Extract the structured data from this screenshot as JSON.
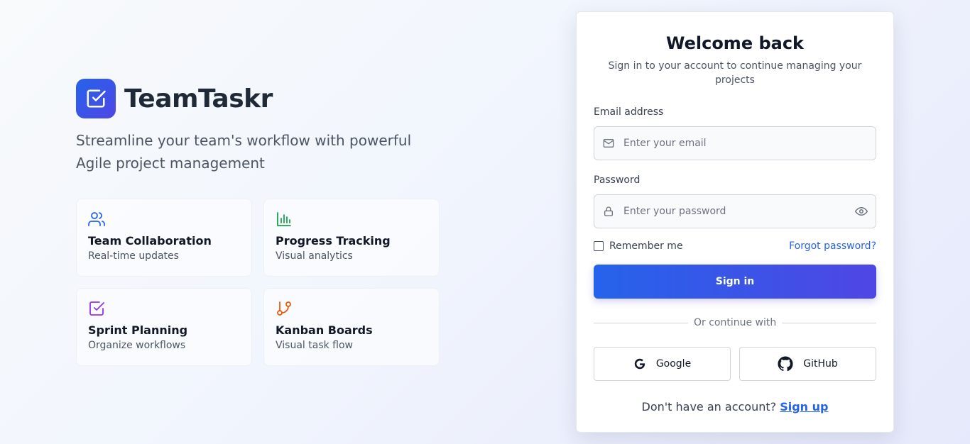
{
  "brand": {
    "name": "TeamTaskr",
    "tagline": "Streamline your team's workflow with powerful Agile project management"
  },
  "features": [
    {
      "icon": "users-icon",
      "title": "Team Collaboration",
      "subtitle": "Real-time updates",
      "color": "#2563eb"
    },
    {
      "icon": "bar-chart-icon",
      "title": "Progress Tracking",
      "subtitle": "Visual analytics",
      "color": "#16a34a"
    },
    {
      "icon": "check-square-icon",
      "title": "Sprint Planning",
      "subtitle": "Organize workflows",
      "color": "#9333ea"
    },
    {
      "icon": "git-branch-icon",
      "title": "Kanban Boards",
      "subtitle": "Visual task flow",
      "color": "#ea580c"
    }
  ],
  "login": {
    "title": "Welcome back",
    "subtitle": "Sign in to your account to continue managing your projects",
    "email_label": "Email address",
    "email_placeholder": "Enter your email",
    "email_value": "",
    "password_label": "Password",
    "password_placeholder": "Enter your password",
    "password_value": "",
    "remember_label": "Remember me",
    "remember_checked": false,
    "forgot_label": "Forgot password?",
    "signin_label": "Sign in",
    "divider_text": "Or continue with",
    "google_label": "Google",
    "github_label": "GitHub",
    "signup_prompt": "Don't have an account?",
    "signup_label": "Sign up"
  },
  "colors": {
    "primary": "#2563eb",
    "primary_end": "#4f46e5"
  }
}
